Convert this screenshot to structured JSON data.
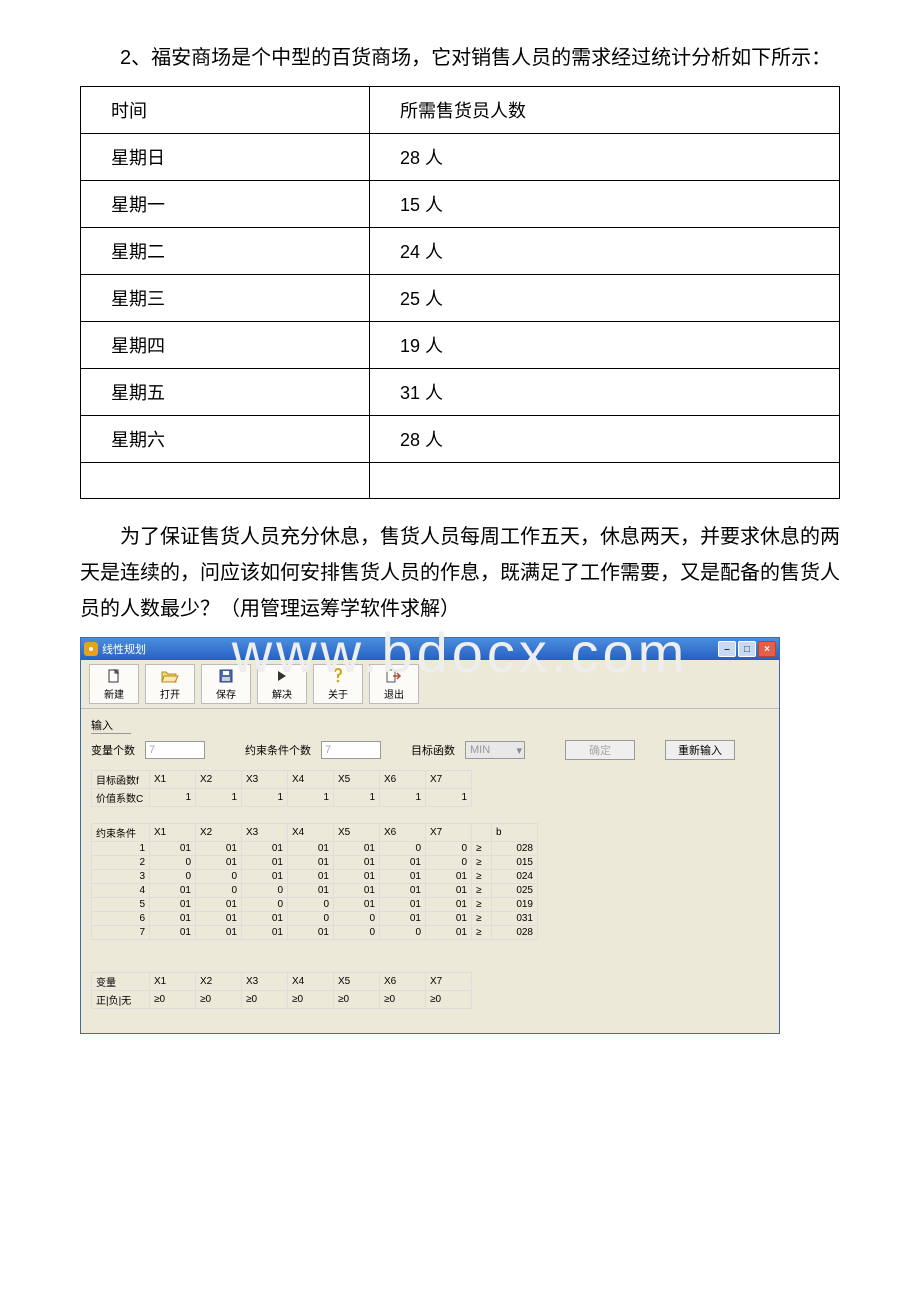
{
  "watermark": "www.bdocx.com",
  "problem": {
    "intro": "2、福安商场是个中型的百货商场，它对销售人员的需求经过统计分析如下所示：",
    "table_header_time": "时间",
    "table_header_count": "所需售货员人数",
    "rows": [
      {
        "day": "星期日",
        "count": "28 人"
      },
      {
        "day": "星期一",
        "count": "15 人"
      },
      {
        "day": "星期二",
        "count": "24 人"
      },
      {
        "day": "星期三",
        "count": "25 人"
      },
      {
        "day": "星期四",
        "count": "19 人"
      },
      {
        "day": "星期五",
        "count": "31 人"
      },
      {
        "day": "星期六",
        "count": "28 人"
      }
    ],
    "body": "为了保证售货人员充分休息，售货人员每周工作五天，休息两天，并要求休息的两天是连续的，问应该如何安排售货人员的作息，既满足了工作需要，又是配备的售货人员的人数最少？（用管理运筹学软件求解）"
  },
  "app": {
    "title": "线性规划",
    "toolbar": {
      "new": "新建",
      "open": "打开",
      "save": "保存",
      "solve": "解决",
      "about": "关于",
      "exit": "退出"
    },
    "section_input": "输入",
    "labels": {
      "var_count": "变量个数",
      "constraint_count": "约束条件个数",
      "objective": "目标函数",
      "confirm": "确定",
      "reenter": "重新输入",
      "obj_row": "目标函数f",
      "coef_row": "价值系数C",
      "constraints": "约束条件",
      "var_section": "变量",
      "sign_row": "正|负|无"
    },
    "inputs": {
      "var_count": "7",
      "constraint_count": "7",
      "obj_type": "MIN"
    },
    "vars": [
      "X1",
      "X2",
      "X3",
      "X4",
      "X5",
      "X6",
      "X7"
    ],
    "obj_coefs": [
      "1",
      "1",
      "1",
      "1",
      "1",
      "1",
      "1"
    ],
    "constraints": [
      {
        "n": "1",
        "c": [
          "01",
          "01",
          "01",
          "01",
          "01",
          "0",
          "0"
        ],
        "op": "≥",
        "b": "028"
      },
      {
        "n": "2",
        "c": [
          "0",
          "01",
          "01",
          "01",
          "01",
          "01",
          "0"
        ],
        "op": "≥",
        "b": "015"
      },
      {
        "n": "3",
        "c": [
          "0",
          "0",
          "01",
          "01",
          "01",
          "01",
          "01"
        ],
        "op": "≥",
        "b": "024"
      },
      {
        "n": "4",
        "c": [
          "01",
          "0",
          "0",
          "01",
          "01",
          "01",
          "01"
        ],
        "op": "≥",
        "b": "025"
      },
      {
        "n": "5",
        "c": [
          "01",
          "01",
          "0",
          "0",
          "01",
          "01",
          "01"
        ],
        "op": "≥",
        "b": "019"
      },
      {
        "n": "6",
        "c": [
          "01",
          "01",
          "01",
          "0",
          "0",
          "01",
          "01"
        ],
        "op": "≥",
        "b": "031"
      },
      {
        "n": "7",
        "c": [
          "01",
          "01",
          "01",
          "01",
          "0",
          "0",
          "01"
        ],
        "op": "≥",
        "b": "028"
      }
    ],
    "sign": [
      "≥0",
      "≥0",
      "≥0",
      "≥0",
      "≥0",
      "≥0",
      "≥0"
    ],
    "b_label": "b"
  }
}
